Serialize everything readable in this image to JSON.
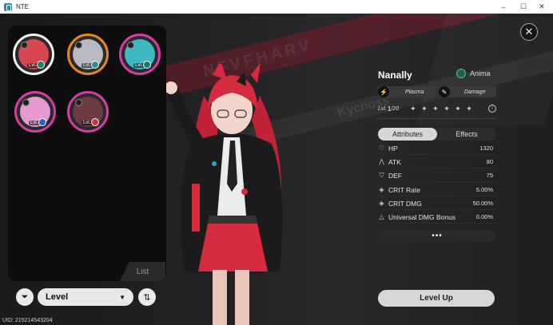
{
  "window": {
    "title": "NTE",
    "minimize": "–",
    "maximize": "☐",
    "close": "✕"
  },
  "background": {
    "banner_text": "NFVFHARV",
    "watermark_text": "Kycnoss"
  },
  "roster": {
    "characters": [
      {
        "level": "Lvl. 1",
        "ring": "#f2f2f2",
        "face": "#d8474f",
        "elem": "#1f7a66",
        "selected": true
      },
      {
        "level": "Lvl. 1",
        "ring": "#e8871e",
        "face": "#b9b9c4",
        "elem": "#3a8c8c",
        "selected": false
      },
      {
        "level": "Lvl. 1",
        "ring": "#d43ea2",
        "face": "#3fb8c2",
        "elem": "#1f7a66",
        "selected": false
      },
      {
        "level": "Lvl. 1",
        "ring": "#d43ea2",
        "face": "#e59bd0",
        "elem": "#2b66c4",
        "selected": false
      },
      {
        "level": "Lvl. 1",
        "ring": "#d43ea2",
        "face": "#6d3a42",
        "elem": "#c43a3a",
        "selected": false
      }
    ],
    "list_tab_label": "List"
  },
  "controls": {
    "sort_label": "Level",
    "filter_icon": "filter-icon",
    "order_icon": "sort-order-icon"
  },
  "uid": "UID: 215214543204",
  "character": {
    "name": "Nanally",
    "element": "Anima",
    "tags": [
      {
        "icon": "plasma-icon",
        "label": "Plasma"
      },
      {
        "icon": "damage-icon",
        "label": "Damage"
      }
    ],
    "level_label": "Lvl.",
    "level_value": "1",
    "level_max": "/20",
    "stars": "✦ ✦ ✦ ✦ ✦ ✦"
  },
  "tabs": {
    "attributes": "Attributes",
    "effects": "Effects"
  },
  "attributes": [
    {
      "icon": "hp-icon",
      "glyph": "♡",
      "label": "HP",
      "value": "1320"
    },
    {
      "icon": "atk-icon",
      "glyph": "⋀",
      "label": "ATK",
      "value": "80"
    },
    {
      "icon": "def-icon",
      "glyph": "⛉",
      "label": "DEF",
      "value": "75"
    },
    {
      "icon": "crit-rate-icon",
      "glyph": "◈",
      "label": "CRIT Rate",
      "value": "5.00%"
    },
    {
      "icon": "crit-dmg-icon",
      "glyph": "◈",
      "label": "CRIT DMG",
      "value": "50.00%"
    },
    {
      "icon": "universal-dmg-icon",
      "glyph": "△",
      "label": "Universal DMG Bonus",
      "value": "0.00%"
    }
  ],
  "more_label": "•••",
  "level_up_label": "Level Up",
  "colors": {
    "accent_red": "#c8304a",
    "panel_dark": "#0d0d0e",
    "button_light": "#d7d7d7"
  }
}
